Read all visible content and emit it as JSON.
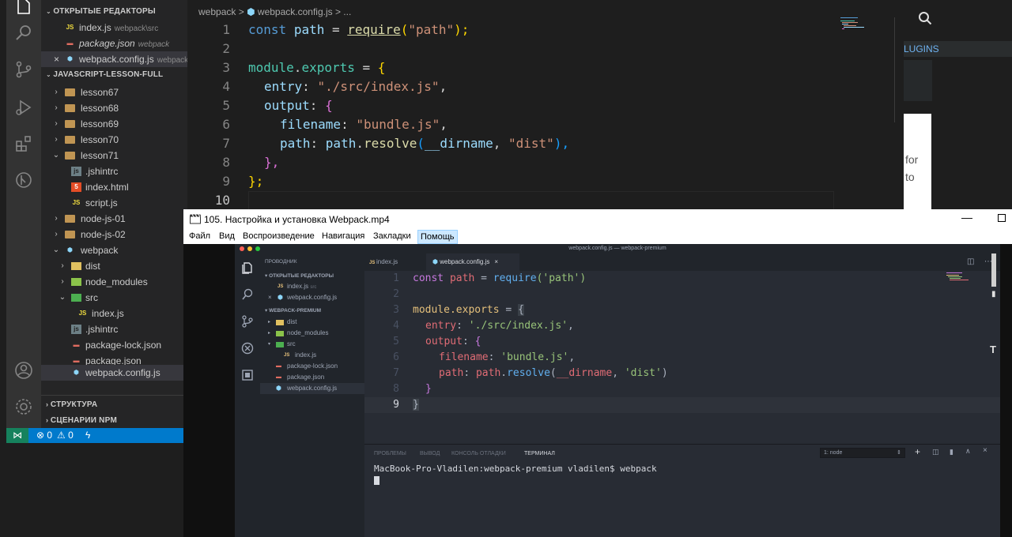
{
  "back_vscode": {
    "breadcrumb": {
      "folder": "webpack",
      "sep1": ">",
      "file": "webpack.config.js",
      "sep2": "> ..."
    },
    "open_editors_title": "ОТКРЫТЫЕ РЕДАКТОРЫ",
    "open_editors": [
      {
        "name": "index.js",
        "hint": "webpack\\src",
        "icon": "JS"
      },
      {
        "name": "package.json",
        "hint": "webpack",
        "icon": "{}"
      },
      {
        "name": "webpack.config.js",
        "hint": "webpack",
        "icon": "wp"
      }
    ],
    "workspace_title": "JAVASCRIPT-LESSON-FULL",
    "tree": [
      {
        "name": "lesson67"
      },
      {
        "name": "lesson68"
      },
      {
        "name": "lesson69"
      },
      {
        "name": "lesson70"
      },
      {
        "name": "lesson71"
      },
      {
        "name": ".jshintrc"
      },
      {
        "name": "index.html"
      },
      {
        "name": "script.js"
      },
      {
        "name": "node-js-01"
      },
      {
        "name": "node-js-02"
      },
      {
        "name": "webpack"
      },
      {
        "name": "dist"
      },
      {
        "name": "node_modules"
      },
      {
        "name": "src"
      },
      {
        "name": "index.js"
      },
      {
        "name": ".jshintrc"
      },
      {
        "name": "package-lock.json"
      },
      {
        "name": "package.json"
      },
      {
        "name": "webpack.config.js"
      }
    ],
    "structure_title": "СТРУКТУРА",
    "npm_title": "СЦЕНАРИИ NPM",
    "status": {
      "errors": "0",
      "warnings": "0"
    },
    "code_lines": [
      "1",
      "2",
      "3",
      "4",
      "5",
      "6",
      "7",
      "8",
      "9",
      "10"
    ],
    "code": {
      "l1_const": "const",
      "l1_path": "path",
      "l1_eq": "=",
      "l1_req": "require",
      "l1_p1": "(",
      "l1_str": "\"path\"",
      "l1_p2": ");",
      "l3_mod": "module",
      "l3_dot": ".",
      "l3_exp": "exports",
      "l3_eq": " = ",
      "l3_br": "{",
      "l4_key": "entry",
      "l4_col": ": ",
      "l4_str": "\"./src/index.js\"",
      "l4_c": ",",
      "l5_key": "output",
      "l5_col": ": ",
      "l5_br": "{",
      "l6_key": "filename",
      "l6_col": ": ",
      "l6_str": "\"bundle.js\"",
      "l6_c": ",",
      "l7_key": "path",
      "l7_col": ": ",
      "l7_obj": "path",
      "l7_dot": ".",
      "l7_fn": "resolve",
      "l7_p": "(",
      "l7_arg": "__dirname",
      "l7_c": ", ",
      "l7_str": "\"dist\"",
      "l7_end": "),",
      "l8": "},",
      "l9": "};"
    },
    "right_fragment": {
      "tab": "LUGINS",
      "text1": "for",
      "text2": "to"
    }
  },
  "video_window": {
    "title": "105. Настройка и установка Webpack.mp4",
    "menu": [
      "Файл",
      "Вид",
      "Воспроизведение",
      "Навигация",
      "Закладки",
      "Помощь"
    ],
    "mac": {
      "title": "webpack.config.js — webpack-premium",
      "explorer_label": "ПРОВОДНИК",
      "open_editors_title": "ОТКРЫТЫЕ РЕДАКТОРЫ",
      "open_editors": [
        {
          "name": "index.js",
          "hint": "src"
        },
        {
          "name": "webpack.config.js",
          "hint": ""
        }
      ],
      "project_title": "WEBPACK-PREMIUM",
      "tree": [
        {
          "name": "dist"
        },
        {
          "name": "node_modules"
        },
        {
          "name": "src"
        },
        {
          "name": "index.js"
        },
        {
          "name": "package-lock.json"
        },
        {
          "name": "package.json"
        },
        {
          "name": "webpack.config.js"
        }
      ],
      "tabs": [
        "index.js",
        "webpack.config.js"
      ],
      "code_lines": [
        "1",
        "2",
        "3",
        "4",
        "5",
        "6",
        "7",
        "8",
        "9"
      ],
      "code": {
        "l1_const": "const",
        "l1_path": "path",
        "l1_eq": "=",
        "l1_req": "require",
        "l1_str": "('path')",
        "l3_mod": "module",
        "l3_exp": ".exports",
        "l3_eq": " = ",
        "l3_br": "{",
        "l4_key": "entry",
        "l4_str": "'./src/index.js'",
        "l5_key": "output",
        "l5_br": "{",
        "l6_key": "filename",
        "l6_str": "'bundle.js'",
        "l7_key": "path",
        "l7_obj": "path",
        "l7_fn": "resolve",
        "l7_arg": "__dirname",
        "l7_str": "'dist'",
        "l8": "}",
        "l9": "}"
      },
      "panel_tabs": [
        "ПРОБЛЕМЫ",
        "ВЫВОД",
        "КОНСОЛЬ ОТЛАДКИ",
        "ТЕРМИНАЛ"
      ],
      "terminal_select": "1: node",
      "terminal_line": "MacBook-Pro-Vladilen:webpack-premium vladilen$ webpack"
    }
  },
  "colors": {
    "status_bar": "#007acc",
    "remote": "#16825d",
    "editor_bg": "#1e1e1e",
    "mac_bg": "#282c34"
  }
}
